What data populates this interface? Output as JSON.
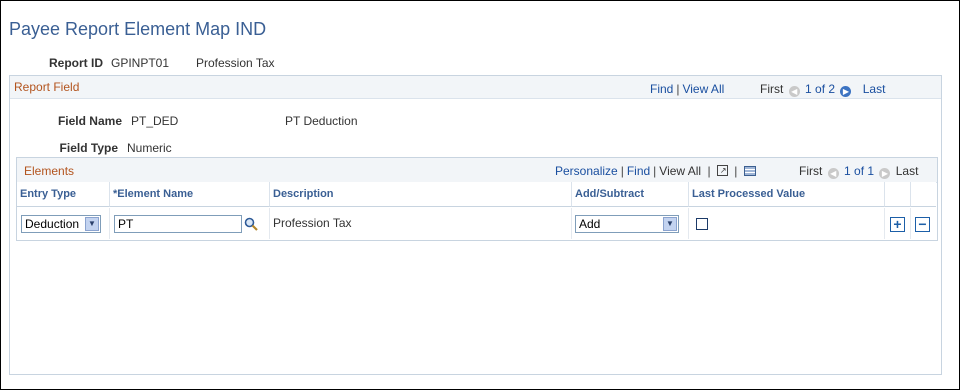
{
  "page": {
    "title": "Payee Report Element Map IND"
  },
  "report": {
    "id_label": "Report ID",
    "id_value": "GPINPT01",
    "description": "Profession Tax"
  },
  "report_field": {
    "title": "Report Field",
    "nav": {
      "find": "Find",
      "view_all": "View All",
      "first": "First",
      "range": "1 of 2",
      "last": "Last"
    },
    "field_name_label": "Field Name",
    "field_name_value": "PT_DED",
    "field_name_desc": "PT Deduction",
    "field_type_label": "Field Type",
    "field_type_value": "Numeric"
  },
  "elements": {
    "title": "Elements",
    "nav": {
      "personalize": "Personalize",
      "find": "Find",
      "view_all": "View All",
      "first": "First",
      "range": "1 of 1",
      "last": "Last"
    },
    "columns": {
      "entry_type": "Entry Type",
      "element_name": "*Element Name",
      "description": "Description",
      "add_subtract": "Add/Subtract",
      "last_processed": "Last Processed Value"
    },
    "rows": [
      {
        "entry_type": "Deduction",
        "element_name": "PT",
        "description": "Profession Tax",
        "add_subtract": "Add",
        "last_processed": false
      }
    ]
  }
}
